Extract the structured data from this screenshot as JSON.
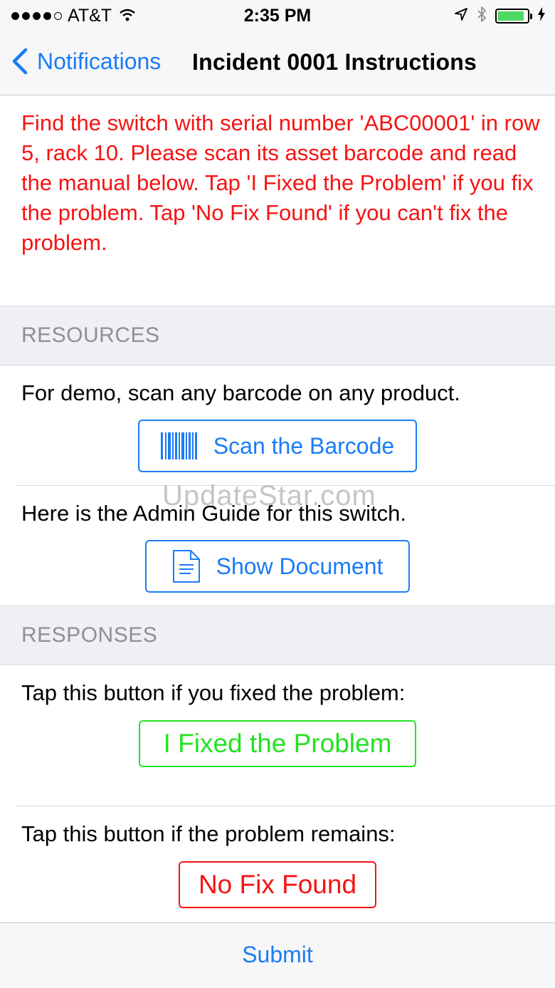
{
  "status_bar": {
    "signal_bars": 5,
    "signal_filled": 4,
    "carrier": "AT&T",
    "time": "2:35 PM",
    "battery_level": 0.9,
    "icons": [
      "wifi-icon",
      "location-arrow-icon",
      "bluetooth-icon",
      "battery-icon",
      "charging-bolt-icon"
    ]
  },
  "nav": {
    "back_label": "Notifications",
    "title": "Incident 0001 Instructions"
  },
  "instructions": "Find the switch with serial number 'ABC00001' in row 5, rack 10. Please scan its asset barcode and read the manual below. Tap 'I Fixed the Problem' if you fix the problem. Tap 'No Fix Found' if you can't fix the problem.",
  "resources": {
    "header": "RESOURCES",
    "scan_text": "For demo, scan any barcode on any product.",
    "scan_button": "Scan the Barcode",
    "doc_text": "Here is the Admin Guide for this switch.",
    "doc_button": "Show Document"
  },
  "responses": {
    "header": "RESPONSES",
    "fixed_text": "Tap this button if you fixed the problem:",
    "fixed_button": "I Fixed the Problem",
    "remains_text": "Tap this button if the problem remains:",
    "nofix_button": "No Fix Found"
  },
  "watermark": "UpdateStar.com",
  "toolbar": {
    "submit": "Submit"
  },
  "colors": {
    "tint": "#1a7cf5",
    "instruction_red": "#f51313",
    "fixed_green": "#22e322",
    "battery_green": "#4cd964"
  }
}
